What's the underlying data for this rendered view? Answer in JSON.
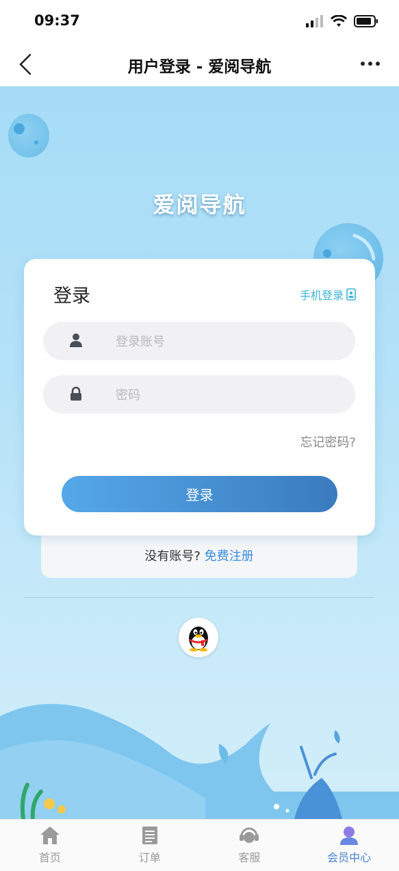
{
  "status_bar": {
    "time": "09:37"
  },
  "nav": {
    "title": "用户登录 - 爱阅导航"
  },
  "hero": {
    "brand_title": "爱阅导航"
  },
  "login": {
    "heading": "登录",
    "phone_login": "手机登录",
    "account_placeholder": "登录账号",
    "account_value": "",
    "password_placeholder": "密码",
    "password_value": "",
    "forgot": "忘记密码?",
    "submit": "登录",
    "no_account": "没有账号?",
    "register": "免费注册"
  },
  "tabs": [
    {
      "label": "首页",
      "icon": "home-icon"
    },
    {
      "label": "订单",
      "icon": "order-icon"
    },
    {
      "label": "客服",
      "icon": "customer-service-icon"
    },
    {
      "label": "会员中心",
      "icon": "member-icon",
      "active": true
    }
  ],
  "colors": {
    "accent": "#3a7bbf",
    "link": "#3a8be0",
    "phone_login": "#3bb3d8",
    "active_tab": "#4a7fd0",
    "hero_bg": "#a6dcf7"
  }
}
